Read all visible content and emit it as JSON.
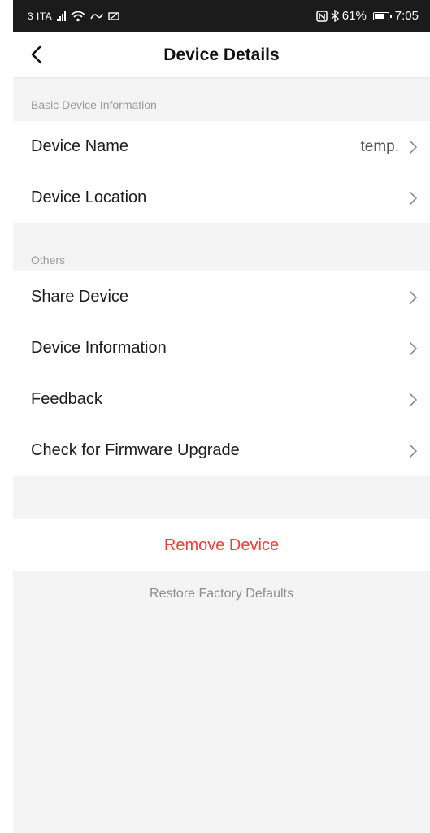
{
  "status_bar": {
    "carrier": "3 ITA",
    "battery_percent": "61%",
    "time": "7:05"
  },
  "header": {
    "title": "Device Details"
  },
  "sections": {
    "basic": {
      "label": "Basic Device Information",
      "items": [
        {
          "label": "Device Name",
          "value": "temp."
        },
        {
          "label": "Device Location",
          "value": ""
        }
      ]
    },
    "others": {
      "label": "Others",
      "items": [
        {
          "label": "Share Device"
        },
        {
          "label": "Device Information"
        },
        {
          "label": "Feedback"
        },
        {
          "label": "Check for Firmware Upgrade"
        }
      ]
    }
  },
  "actions": {
    "remove_label": "Remove Device",
    "restore_label": "Restore Factory Defaults"
  },
  "colors": {
    "danger": "#e8413d",
    "page_background": "#f4f4f4",
    "status_bar": "#1b1b1b"
  }
}
